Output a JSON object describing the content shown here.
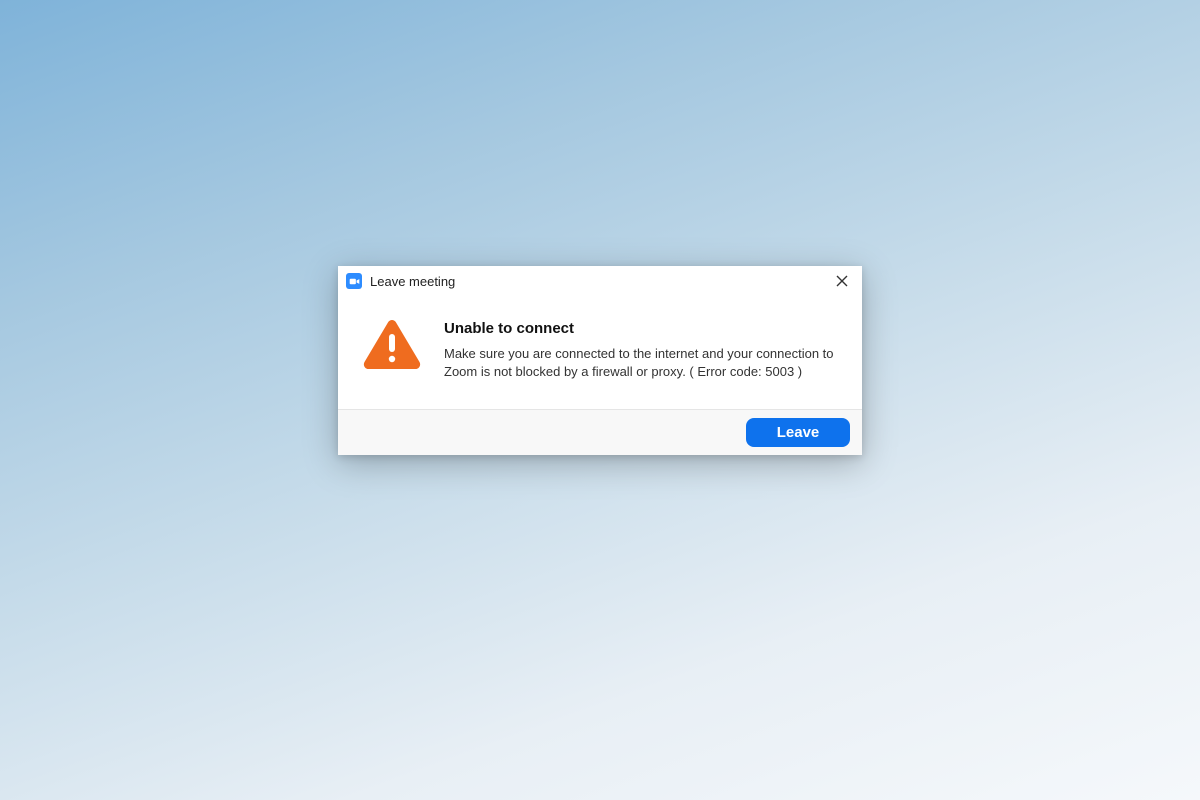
{
  "dialog": {
    "title": "Leave meeting",
    "message_title": "Unable to connect",
    "message_body": "Make sure you are connected to the internet and your connection to Zoom is not blocked by a firewall or proxy. ( Error code: 5003 )",
    "leave_button": "Leave"
  }
}
